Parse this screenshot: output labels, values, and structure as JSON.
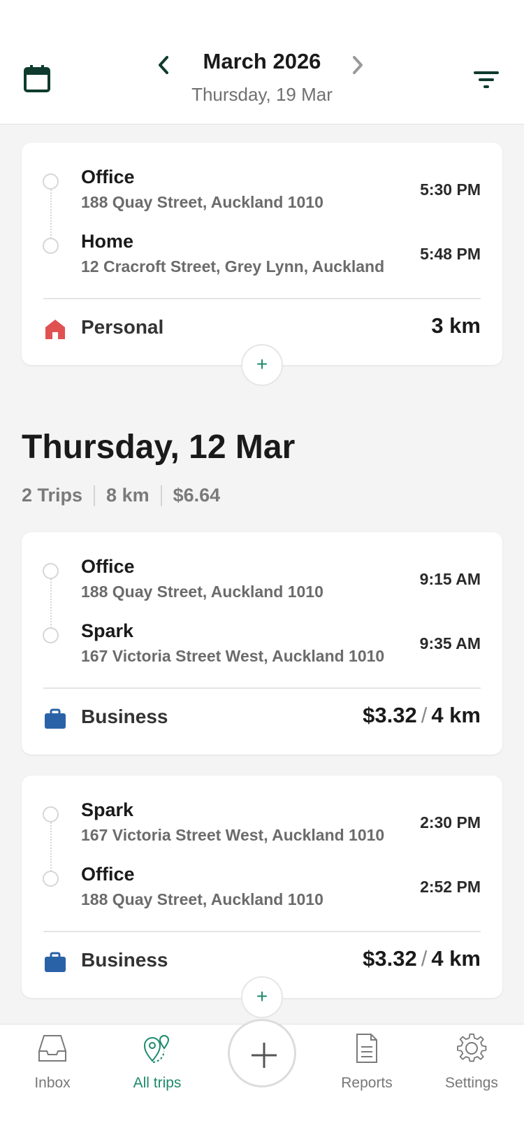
{
  "header": {
    "month_title": "March 2026",
    "selected_date": "Thursday, 19 Mar"
  },
  "trips_top": [
    {
      "from": {
        "name": "Office",
        "address": "188 Quay Street, Auckland 1010",
        "time": "5:30 PM"
      },
      "to": {
        "name": "Home",
        "address": "12 Cracroft Street, Grey Lynn, Auckland",
        "time": "5:48 PM"
      },
      "category": "Personal",
      "distance": "3 km"
    }
  ],
  "day_group": {
    "title": "Thursday, 12 Mar",
    "stats": {
      "trips": "2 Trips",
      "distance": "8 km",
      "amount": "$6.64"
    },
    "trips": [
      {
        "from": {
          "name": "Office",
          "address": "188 Quay Street, Auckland 1010",
          "time": "9:15 AM"
        },
        "to": {
          "name": "Spark",
          "address": "167 Victoria Street West, Auckland 1010",
          "time": "9:35 AM"
        },
        "category": "Business",
        "amount": "$3.32",
        "distance": "4 km"
      },
      {
        "from": {
          "name": "Spark",
          "address": "167 Victoria Street West, Auckland 1010",
          "time": "2:30 PM"
        },
        "to": {
          "name": "Office",
          "address": "188 Quay Street, Auckland 1010",
          "time": "2:52 PM"
        },
        "category": "Business",
        "amount": "$3.32",
        "distance": "4 km"
      }
    ]
  },
  "amount_separator": "/",
  "add_symbol": "+",
  "tabbar": {
    "inbox": "Inbox",
    "all_trips": "All trips",
    "reports": "Reports",
    "settings": "Settings"
  },
  "colors": {
    "accent": "#1c8a6a",
    "personal": "#e05252",
    "business": "#2a62a8",
    "dark_green": "#0e3b2e"
  }
}
